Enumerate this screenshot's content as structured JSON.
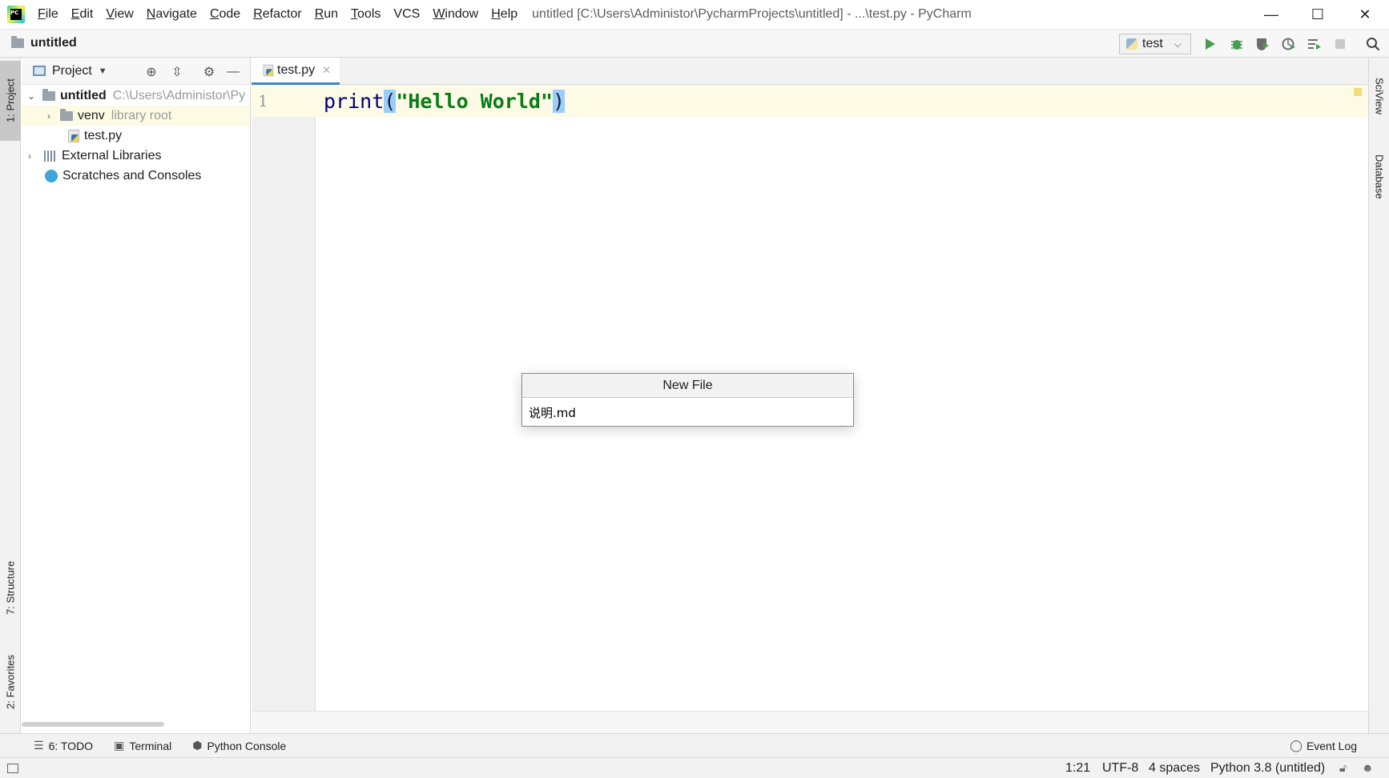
{
  "titlebar": {
    "menu": [
      {
        "label": "File",
        "mn": "F",
        "rest": "ile"
      },
      {
        "label": "Edit",
        "mn": "E",
        "rest": "dit"
      },
      {
        "label": "View",
        "mn": "V",
        "rest": "iew"
      },
      {
        "label": "Navigate",
        "mn": "N",
        "rest": "avigate"
      },
      {
        "label": "Code",
        "mn": "C",
        "rest": "ode"
      },
      {
        "label": "Refactor",
        "mn": "R",
        "rest": "efactor"
      },
      {
        "label": "Run",
        "mn": "R",
        "rest": "un"
      },
      {
        "label": "Tools",
        "mn": "T",
        "rest": "ools"
      },
      {
        "label": "VCS",
        "mn": "",
        "rest": "VCS"
      },
      {
        "label": "Window",
        "mn": "W",
        "rest": "indow"
      },
      {
        "label": "Help",
        "mn": "H",
        "rest": "elp"
      }
    ],
    "window_title": "untitled [C:\\Users\\Administor\\PycharmProjects\\untitled] - ...\\test.py - PyCharm",
    "controls": {
      "minimize": "—",
      "maximize": "☐",
      "close": "✕"
    }
  },
  "navbar": {
    "project_name": "untitled",
    "run_config": "test",
    "buttons": [
      "run-icon",
      "debug-icon",
      "coverage-icon",
      "profile-icon",
      "concurrency-icon",
      "stop-icon",
      "search-icon"
    ]
  },
  "left_stripe": {
    "project_tab": "1: Project",
    "structure_tab": "7: Structure",
    "favorites_tab": "2: Favorites"
  },
  "right_stripe": {
    "sciview_tab": "SciView",
    "database_tab": "Database"
  },
  "project_panel": {
    "title": "Project",
    "tree": {
      "root_name": "untitled",
      "root_path": "C:\\Users\\Administor\\Py",
      "venv_name": "venv",
      "venv_note": "library root",
      "file_name": "test.py",
      "external_libraries": "External Libraries",
      "scratches": "Scratches and Consoles"
    }
  },
  "editor": {
    "tab_label": "test.py",
    "line_number": "1",
    "code": {
      "fn": "print",
      "open_paren": "(",
      "string": "\"Hello World\"",
      "close_paren": ")"
    }
  },
  "dialog": {
    "title": "New File",
    "input_value": "说明.md"
  },
  "tool_windows": {
    "todo": "6: TODO",
    "terminal": "Terminal",
    "python_console": "Python Console",
    "event_log": "Event Log"
  },
  "status_bar": {
    "position": "1:21",
    "encoding": "UTF-8",
    "indent": "4 spaces",
    "interpreter": "Python 3.8 (untitled)"
  },
  "colors": {
    "accent": "#4083c9",
    "run_green": "#499c54",
    "current_line": "#fdfae6",
    "string_green": "#067d17",
    "keyword_blue": "#000080"
  }
}
